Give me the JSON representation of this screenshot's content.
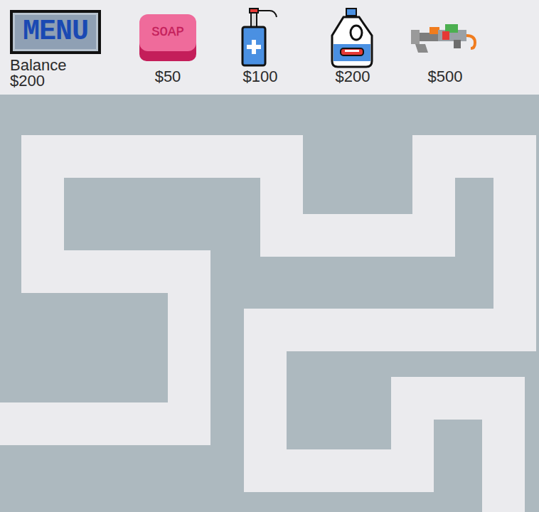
{
  "header": {
    "menu": {
      "label": "MENU"
    },
    "balance": {
      "label": "Balance",
      "value": "$200"
    }
  },
  "shop": [
    {
      "kind": "soap",
      "label": "SOAP",
      "price": "$50"
    },
    {
      "kind": "sanitizer",
      "price": "$100"
    },
    {
      "kind": "bleach",
      "price": "$200"
    },
    {
      "kind": "sprayer",
      "price": "$500"
    }
  ]
}
